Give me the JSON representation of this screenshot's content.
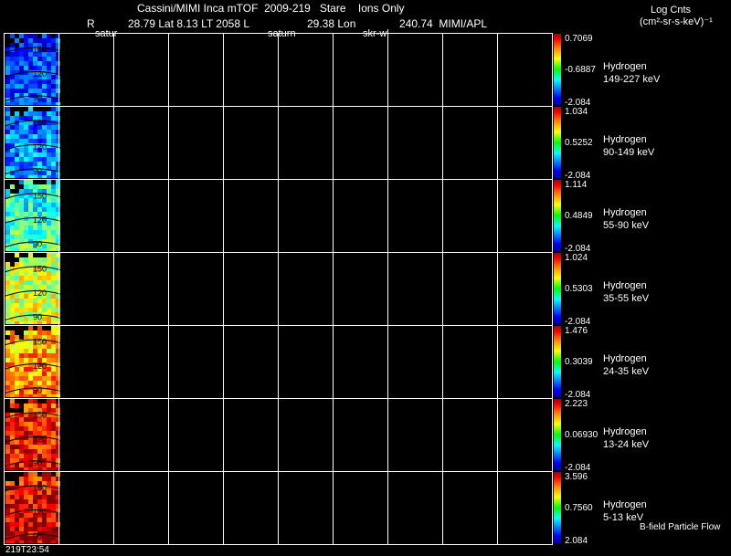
{
  "header": {
    "title": "Cassini/MIMI Inca mTOF  2009-219   Stare    Ions Only",
    "line2_R": "R",
    "line2_rest": "28.79 Lat 8.13 LT 2058 L",
    "line2_lon": "29.38 Lon",
    "line2_val": "240.74  MIMI/APL",
    "sub_satur": "satur",
    "sub_saturn": "saturn",
    "sub_skr": "skr-wl"
  },
  "units": {
    "line1": "Log Cnts",
    "line2": "(cm²-sr-s-keV)⁻¹"
  },
  "footer": {
    "time": "219T23:54",
    "legend": "B-field Particle Flow"
  },
  "colors": {
    "background": "#000000",
    "grid": "#ffffff",
    "contours": "#000000"
  },
  "chart_data": {
    "type": "heatmap",
    "description_panels": [
      {
        "species": "Hydrogen",
        "energy": "149-227 keV",
        "max": "0.7069",
        "mid": "-0.6887",
        "min": "-2.084",
        "contour_labels": [
          "150",
          "120",
          "90"
        ],
        "level": 0.15
      },
      {
        "species": "Hydrogen",
        "energy": "90-149 keV",
        "max": "1.034",
        "mid": "0.5252",
        "min": "-2.084",
        "contour_labels": [
          "150",
          "120",
          "90"
        ],
        "level": 0.22
      },
      {
        "species": "Hydrogen",
        "energy": "55-90 keV",
        "max": "1.114",
        "mid": "0.4849",
        "min": "-2.084",
        "contour_labels": [
          "150",
          "120",
          "90"
        ],
        "level": 0.38
      },
      {
        "species": "Hydrogen",
        "energy": "35-55 keV",
        "max": "1.024",
        "mid": "0.5303",
        "min": "-2.084",
        "contour_labels": [
          "150",
          "120",
          "90"
        ],
        "level": 0.55
      },
      {
        "species": "Hydrogen",
        "energy": "24-35 keV",
        "max": "1.476",
        "mid": "0.3039",
        "min": "-2.084",
        "contour_labels": [
          "150",
          "120",
          "90"
        ],
        "level": 0.68
      },
      {
        "species": "Hydrogen",
        "energy": "13-24 keV",
        "max": "2.223",
        "mid": "0.06930",
        "min": "-2.084",
        "contour_labels": [
          "150",
          "120",
          "90"
        ],
        "level": 0.82
      },
      {
        "species": "Hydrogen",
        "energy": "5-13 keV",
        "max": "3.596",
        "mid": "0.7560",
        "min": "2.084",
        "contour_labels": [
          "150",
          "120",
          "90"
        ],
        "level": 0.86
      }
    ],
    "grid": true,
    "grid_columns": 10
  }
}
